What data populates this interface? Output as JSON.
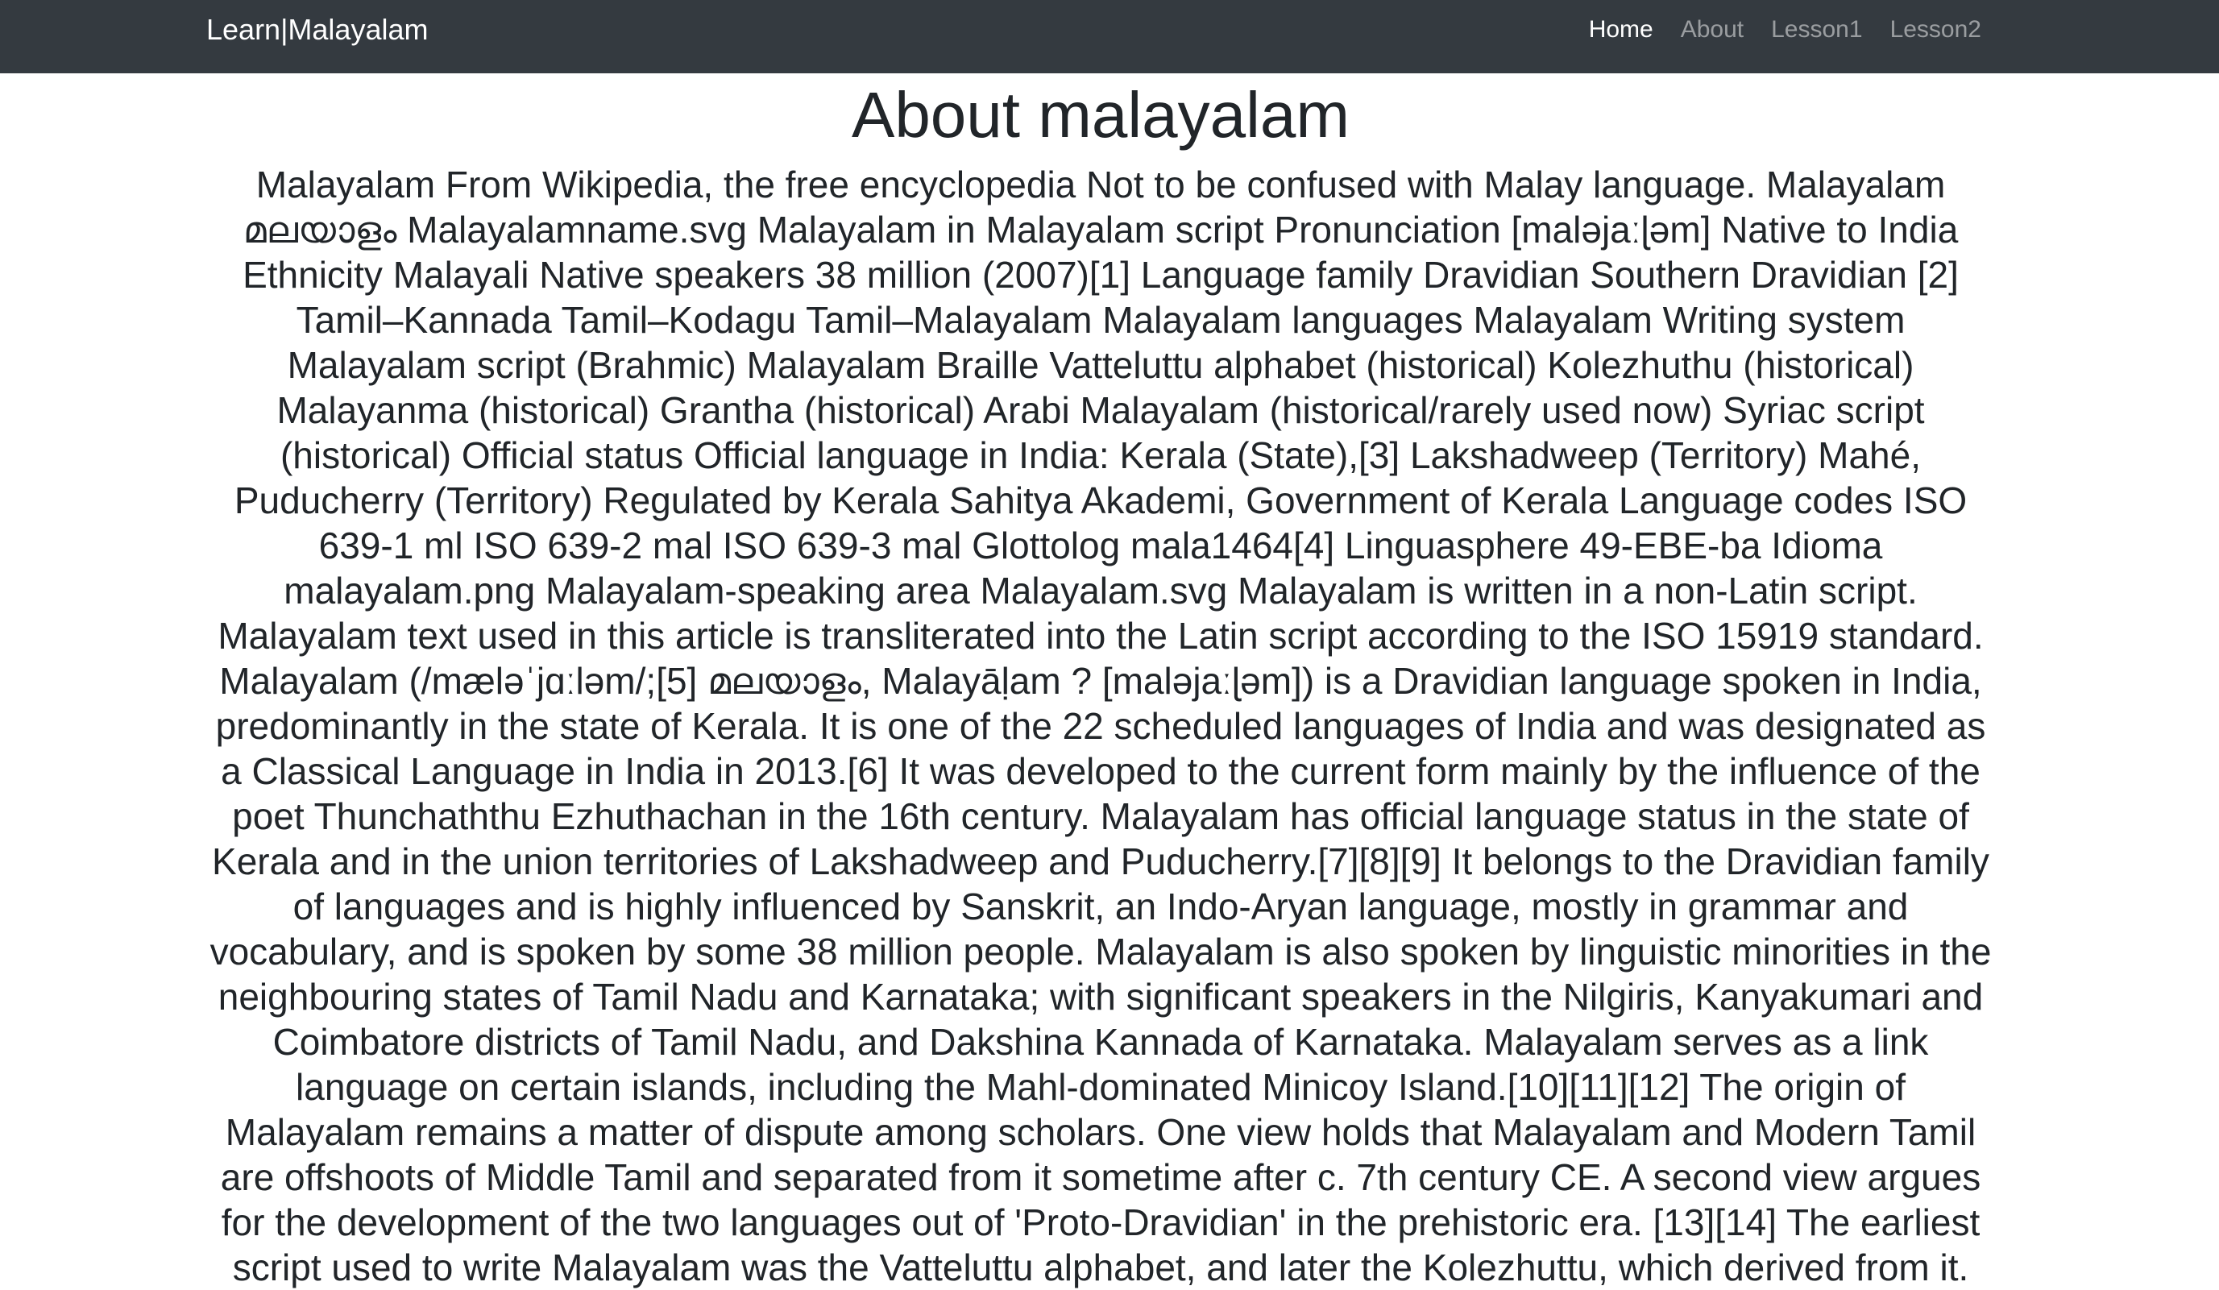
{
  "navbar": {
    "brand": "Learn|Malayalam",
    "links": [
      {
        "label": "Home",
        "active": true
      },
      {
        "label": "About",
        "active": false
      },
      {
        "label": "Lesson1",
        "active": false
      },
      {
        "label": "Lesson2",
        "active": false
      }
    ]
  },
  "main": {
    "title": "About malayalam",
    "body": "Malayalam From Wikipedia, the free encyclopedia Not to be confused with Malay language. Malayalam മലയാളം Malayalamname.svg Malayalam in Malayalam script Pronunciation [maləjaːɭəm] Native to India Ethnicity Malayali Native speakers 38 million (2007)[1] Language family Dravidian Southern Dravidian [2] Tamil–Kannada Tamil–Kodagu Tamil–Malayalam Malayalam languages Malayalam Writing system Malayalam script (Brahmic) Malayalam Braille Vatteluttu alphabet (historical) Kolezhuthu (historical) Malayanma (historical) Grantha (historical) Arabi Malayalam (historical/rarely used now) Syriac script (historical) Official status Official language in India: Kerala (State),[3] Lakshadweep (Territory) Mahé, Puducherry (Territory) Regulated by Kerala Sahitya Akademi, Government of Kerala Language codes ISO 639-1 ml ISO 639-2 mal ISO 639-3 mal Glottolog mala1464[4] Linguasphere 49-EBE-ba Idioma malayalam.png Malayalam-speaking area Malayalam.svg Malayalam is written in a non-Latin script. Malayalam text used in this article is transliterated into the Latin script according to the ISO 15919 standard. Malayalam (/mæləˈjɑːləm/;[5] മലയാളം, Malayāḷam ? [maləjaːɭəm]) is a Dravidian language spoken in India, predominantly in the state of Kerala. It is one of the 22 scheduled languages of India and was designated as a Classical Language in India in 2013.[6] It was developed to the current form mainly by the influence of the poet Thunchaththu Ezhuthachan in the 16th century. Malayalam has official language status in the state of Kerala and in the union territories of Lakshadweep and Puducherry.[7][8][9] It belongs to the Dravidian family of languages and is highly influenced by Sanskrit, an Indo-Aryan language, mostly in grammar and vocabulary, and is spoken by some 38 million people. Malayalam is also spoken by linguistic minorities in the neighbouring states of Tamil Nadu and Karnataka; with significant speakers in the Nilgiris, Kanyakumari and Coimbatore districts of Tamil Nadu, and Dakshina Kannada of Karnataka. Malayalam serves as a link language on certain islands, including the Mahl-dominated Minicoy Island.[10][11][12] The origin of Malayalam remains a matter of dispute among scholars. One view holds that Malayalam and Modern Tamil are offshoots of Middle Tamil and separated from it sometime after c. 7th century CE. A second view argues for the development of the two languages out of 'Proto-Dravidian' in the prehistoric era. [13][14] The earliest script used to write Malayalam was the Vatteluttu alphabet, and later the Kolezhuttu, which derived from it."
  }
}
